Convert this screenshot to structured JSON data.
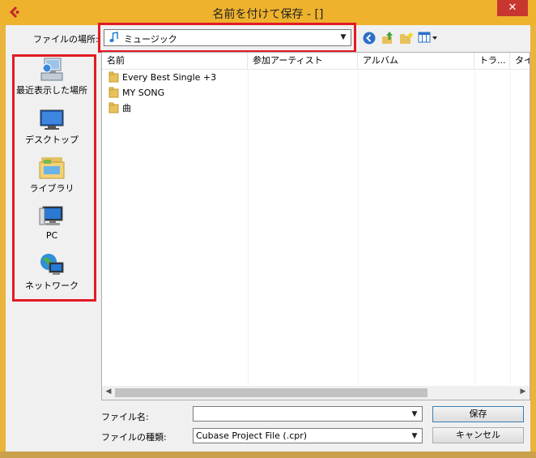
{
  "window": {
    "title": "名前を付けて保存 - []",
    "close_glyph": "✕"
  },
  "location": {
    "label": "ファイルの場所:",
    "value": "ミュージック"
  },
  "toolbar": {
    "icons": [
      "back-icon",
      "up-folder-icon",
      "new-folder-icon",
      "view-menu-icon"
    ]
  },
  "places": [
    {
      "label": "最近表示した場所",
      "icon": "recent-places-icon"
    },
    {
      "label": "デスクトップ",
      "icon": "desktop-icon"
    },
    {
      "label": "ライブラリ",
      "icon": "libraries-icon"
    },
    {
      "label": "PC",
      "icon": "pc-icon"
    },
    {
      "label": "ネットワーク",
      "icon": "network-icon"
    }
  ],
  "columns": [
    "名前",
    "参加アーティスト",
    "アルバム",
    "トラ...",
    "タイ"
  ],
  "files": [
    {
      "name": "Every Best Single +3",
      "icon": "folder-icon"
    },
    {
      "name": "MY SONG",
      "icon": "folder-icon"
    },
    {
      "name": "曲",
      "icon": "folder-icon"
    }
  ],
  "form": {
    "filename_label": "ファイル名:",
    "filename_value": "",
    "filetype_label": "ファイルの種類:",
    "filetype_value": "Cubase Project File (.cpr)"
  },
  "buttons": {
    "save": "保存",
    "cancel": "キャンセル"
  },
  "colors": {
    "title_bar": "#efb22d",
    "highlight_box": "#e21b23",
    "close_button": "#c7372f"
  }
}
